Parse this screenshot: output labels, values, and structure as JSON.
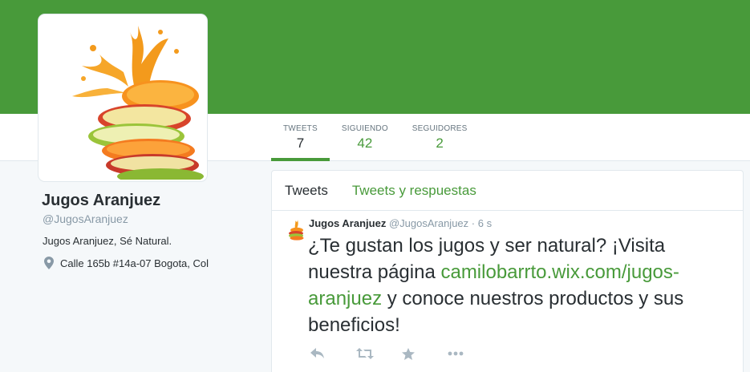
{
  "profile": {
    "name": "Jugos Aranjuez",
    "handle": "@JugosAranjuez",
    "bio": "Jugos Aranjuez, Sé Natural.",
    "location": "Calle 165b #14a-07 Bogota, Col"
  },
  "stats": [
    {
      "label": "TWEETS",
      "value": "7"
    },
    {
      "label": "SIGUIENDO",
      "value": "42"
    },
    {
      "label": "SEGUIDORES",
      "value": "2"
    }
  ],
  "tabs": [
    {
      "label": "Tweets"
    },
    {
      "label": "Tweets y respuestas"
    }
  ],
  "tweet": {
    "name": "Jugos Aranjuez",
    "handle": "@JugosAranjuez",
    "dot": "·",
    "time": "6 s",
    "text_before": "¿Te gustan los jugos y ser natural? ¡Visita nuestra página ",
    "link": "camilobarrto.wix.com/jugos-aranjuez",
    "text_after": " y conoce nuestros productos y sus beneficios!"
  },
  "actions": [
    {
      "icon": "reply-icon"
    },
    {
      "icon": "retweet-icon"
    },
    {
      "icon": "favorite-star-icon"
    },
    {
      "icon": "more-dots-icon"
    }
  ],
  "colors": {
    "accent": "#489a3a",
    "text": "#292f33",
    "muted": "#8899a6",
    "background": "#f5f8fa"
  }
}
